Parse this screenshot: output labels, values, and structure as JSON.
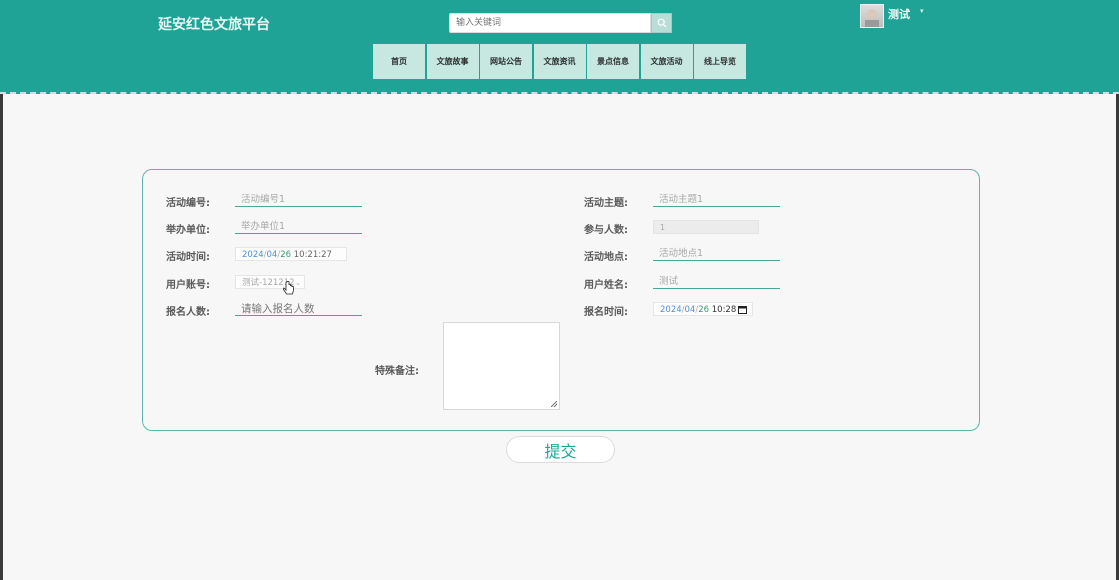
{
  "site_title": "延安红色文旅平台",
  "search": {
    "placeholder": "输入关键词",
    "icon": "search-icon"
  },
  "user": {
    "name": "测试",
    "avatar": "avatar"
  },
  "nav": [
    {
      "label": "首页"
    },
    {
      "label": "文旅故事"
    },
    {
      "label": "网站公告"
    },
    {
      "label": "文旅资讯"
    },
    {
      "label": "景点信息"
    },
    {
      "label": "文旅活动"
    },
    {
      "label": "线上导览"
    }
  ],
  "form": {
    "activity_no": {
      "label": "活动编号:",
      "value": "活动编号1"
    },
    "activity_theme": {
      "label": "活动主题:",
      "value": "活动主题1"
    },
    "organizer": {
      "label": "举办单位:",
      "value": "举办单位1"
    },
    "participants": {
      "label": "参与人数:",
      "value": "1"
    },
    "activity_time": {
      "label": "活动时间:",
      "year": "2024",
      "month": "04",
      "day": "26",
      "time": "10:21:27"
    },
    "activity_place": {
      "label": "活动地点:",
      "value": "活动地点1"
    },
    "user_account": {
      "label": "用户账号:",
      "value": "测试-121212"
    },
    "user_name": {
      "label": "用户姓名:",
      "value": "测试"
    },
    "signup_count": {
      "label": "报名人数:",
      "placeholder": "请输入报名人数"
    },
    "signup_time": {
      "label": "报名时间:",
      "year": "2024",
      "month": "04",
      "day": "26",
      "time": "10:28"
    },
    "remarks": {
      "label": "特殊备注:",
      "value": ""
    }
  },
  "submit_label": "提交",
  "colors": {
    "header": "#1fa396",
    "accent": "#4aa699",
    "nav_bg": "#c6e8e1"
  }
}
